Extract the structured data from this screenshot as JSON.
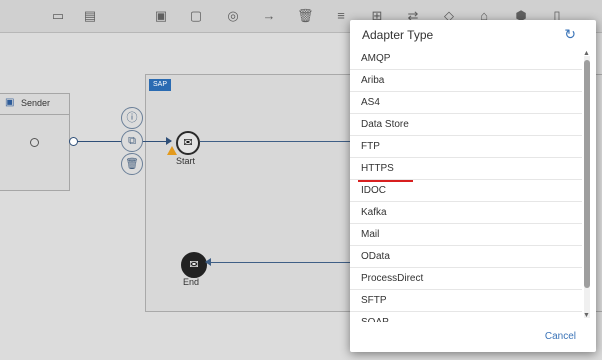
{
  "toolbar": {
    "icons": [
      "copy-icon",
      "paste-icon",
      "clipboard-icon",
      "window-icon",
      "target-icon",
      "arrow-right-icon",
      "delete-icon",
      "menu-icon",
      "add-icon",
      "swap-icon",
      "diamond-icon",
      "lock-icon",
      "settings-icon",
      "file-icon"
    ]
  },
  "canvas": {
    "sender_label": "Sender",
    "start_label": "Start",
    "end_label": "End",
    "pool_logo_text": "SAP"
  },
  "dialog": {
    "title": "Adapter Type",
    "items": [
      "AMQP",
      "Ariba",
      "AS4",
      "Data Store",
      "FTP",
      "HTTPS",
      "IDOC",
      "Kafka",
      "Mail",
      "OData",
      "ProcessDirect",
      "SFTP",
      "SOAP"
    ],
    "cancel_label": "Cancel"
  },
  "colors": {
    "accent": "#3b74b8",
    "highlight": "#d81f1f"
  }
}
